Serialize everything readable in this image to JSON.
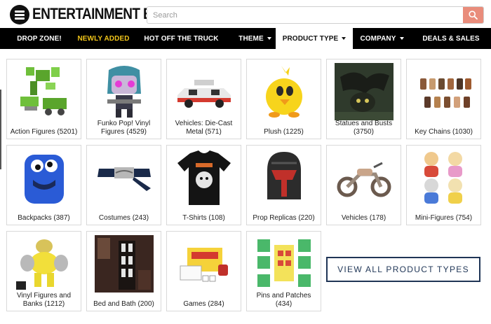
{
  "header": {
    "logo_text": "ENTERTAINMENT EARTH",
    "search_placeholder": "Search"
  },
  "nav": [
    {
      "label": "DROP ZONE!",
      "caret": false
    },
    {
      "label": "NEWLY ADDED",
      "caret": false
    },
    {
      "label": "HOT OFF THE TRUCK",
      "caret": false
    },
    {
      "label": "THEME",
      "caret": true
    },
    {
      "label": "PRODUCT TYPE",
      "caret": true
    },
    {
      "label": "COMPANY",
      "caret": true
    },
    {
      "label": "DEALS & SALES",
      "caret": false
    }
  ],
  "categories": [
    {
      "label": "Action Figures (5201)",
      "icon": "robot-figure-icon"
    },
    {
      "label": "Funko Pop! Vinyl Figures (4529)",
      "icon": "funko-pop-icon"
    },
    {
      "label": "Vehicles: Die-Cast Metal (571)",
      "icon": "die-cast-car-icon"
    },
    {
      "label": "Plush (1225)",
      "icon": "plush-chocobo-icon"
    },
    {
      "label": "Statues and Busts (3750)",
      "icon": "dragon-statue-icon"
    },
    {
      "label": "Key Chains (1030)",
      "icon": "key-chains-icon"
    },
    {
      "label": "Backpacks (387)",
      "icon": "backpack-icon"
    },
    {
      "label": "Costumes (243)",
      "icon": "headband-icon"
    },
    {
      "label": "T-Shirts (108)",
      "icon": "t-shirt-icon"
    },
    {
      "label": "Prop Replicas (220)",
      "icon": "helmet-icon"
    },
    {
      "label": "Vehicles (178)",
      "icon": "motorcycle-icon"
    },
    {
      "label": "Mini-Figures (754)",
      "icon": "mini-figures-icon"
    },
    {
      "label": "Vinyl Figures and Banks (1212)",
      "icon": "vinyl-figure-icon"
    },
    {
      "label": "Bed and Bath (200)",
      "icon": "shower-curtain-icon"
    },
    {
      "label": "Games (284)",
      "icon": "board-game-icon"
    },
    {
      "label": "Pins and Patches (434)",
      "icon": "pins-patches-icon"
    }
  ],
  "view_all_label": "VIEW ALL PRODUCT TYPES",
  "colors": {
    "nav_bg": "#000000",
    "newly_added": "#f0c419",
    "search_button": "#e98c7b",
    "view_all_border": "#1f3556"
  }
}
